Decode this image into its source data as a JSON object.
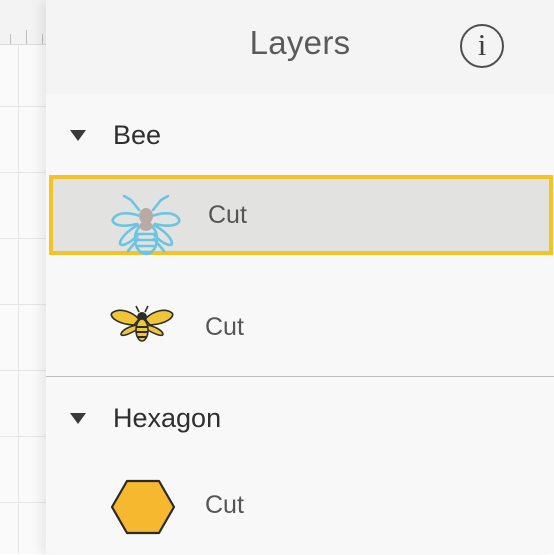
{
  "panel": {
    "title": "Layers",
    "info_icon": "info-icon",
    "info_glyph": "i"
  },
  "groups": [
    {
      "name": "Bee",
      "layers": [
        {
          "label": "Cut",
          "icon": "bee-outline-icon",
          "selected": true
        },
        {
          "label": "Cut",
          "icon": "bee-filled-icon",
          "selected": false
        }
      ]
    },
    {
      "name": "Hexagon",
      "layers": [
        {
          "label": "Cut",
          "icon": "hexagon-icon",
          "selected": false
        }
      ]
    }
  ],
  "colors": {
    "selection_border": "#f5c325",
    "bee_outline": "#6cc4e3",
    "bee_fill": "#f0c538",
    "hexagon_fill": "#f5b82e"
  }
}
